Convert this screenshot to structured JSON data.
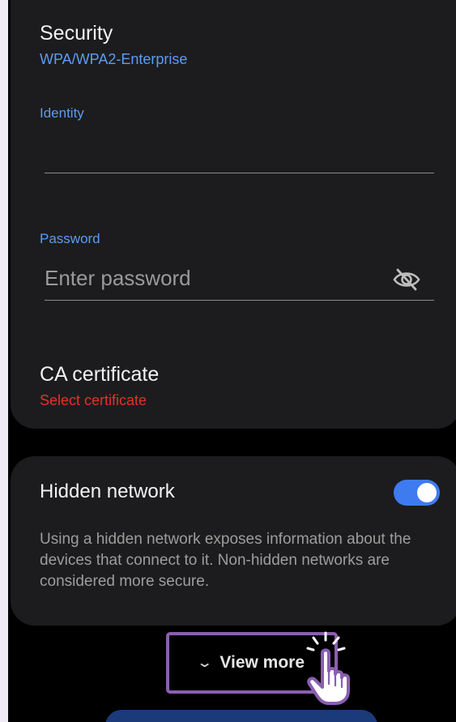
{
  "security": {
    "title": "Security",
    "value": "WPA/WPA2-Enterprise"
  },
  "identity": {
    "label": "Identity",
    "value": ""
  },
  "password": {
    "label": "Password",
    "placeholder": "Enter password"
  },
  "ca_certificate": {
    "title": "CA certificate",
    "value": "Select certificate"
  },
  "hidden_network": {
    "title": "Hidden network",
    "toggle_on": true,
    "description": "Using a hidden network exposes information about the devices that connect to it. Non-hidden networks are considered more secure."
  },
  "view_more": {
    "label": "View more",
    "icon": "chevron-down-icon"
  },
  "colors": {
    "accent": "#3e7bf0",
    "link_blue": "#5b9cf5",
    "warning_red": "#e5302c",
    "card_bg": "#1c1c1e",
    "highlight_frame": "#8a5fb0"
  }
}
